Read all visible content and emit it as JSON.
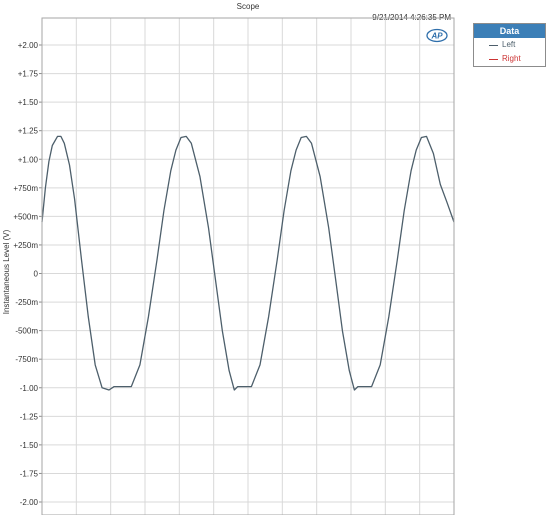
{
  "colors": {
    "left": "#4d5f6b",
    "right": "#cc3333",
    "grid": "#d9d9d9",
    "legend_header": "#3c7fb7"
  },
  "icons": {
    "logo": "ap-logo-icon"
  },
  "chart_data": {
    "type": "line",
    "title": "Scope",
    "timestamp": "9/21/2014 4:26:35 PM",
    "ylabel": "Instantaneous Level (V)",
    "xlabel": "",
    "ylim": [
      -2.1,
      2.1
    ],
    "yticks": [
      "+2.00",
      "+1.75",
      "+1.50",
      "+1.25",
      "+1.00",
      "+750m",
      "+500m",
      "+250m",
      "0",
      "-250m",
      "-500m",
      "-750m",
      "-1.00",
      "-1.25",
      "-1.50",
      "-1.75",
      "-2.00"
    ],
    "ytick_values": [
      2.0,
      1.75,
      1.5,
      1.25,
      1.0,
      0.75,
      0.5,
      0.25,
      0,
      -0.25,
      -0.5,
      -0.75,
      -1.0,
      -1.25,
      -1.5,
      -1.75,
      -2.0
    ],
    "xlim": [
      0,
      12
    ],
    "grid": true,
    "legend": {
      "title": "Data",
      "position": "top-right",
      "entries": [
        "Left",
        "Right"
      ]
    },
    "series": [
      {
        "name": "Left",
        "x": [
          0,
          0.1,
          0.2,
          0.3,
          0.45,
          0.55,
          0.65,
          0.8,
          0.95,
          1.15,
          1.35,
          1.55,
          1.75,
          1.95,
          2.1,
          2.2,
          2.6,
          2.85,
          3.1,
          3.35,
          3.55,
          3.75,
          3.9,
          4.05,
          4.2,
          4.35,
          4.6,
          4.85,
          5.05,
          5.25,
          5.45,
          5.6,
          5.7,
          6.1,
          6.35,
          6.6,
          6.85,
          7.05,
          7.25,
          7.4,
          7.55,
          7.7,
          7.85,
          8.1,
          8.35,
          8.55,
          8.75,
          8.95,
          9.1,
          9.2,
          9.6,
          9.85,
          10.1,
          10.35,
          10.55,
          10.75,
          10.9,
          11.05,
          11.2,
          11.4,
          11.6,
          11.8,
          12.0
        ],
        "y": [
          0.45,
          0.75,
          0.98,
          1.12,
          1.2,
          1.2,
          1.14,
          0.95,
          0.65,
          0.12,
          -0.38,
          -0.8,
          -1.0,
          -1.02,
          -0.99,
          -0.99,
          -0.99,
          -0.8,
          -0.38,
          0.12,
          0.55,
          0.9,
          1.08,
          1.19,
          1.2,
          1.14,
          0.85,
          0.4,
          -0.05,
          -0.5,
          -0.85,
          -1.02,
          -0.99,
          -0.99,
          -0.8,
          -0.38,
          0.12,
          0.55,
          0.9,
          1.08,
          1.19,
          1.2,
          1.14,
          0.85,
          0.4,
          -0.05,
          -0.5,
          -0.85,
          -1.02,
          -0.99,
          -0.99,
          -0.8,
          -0.38,
          0.12,
          0.55,
          0.9,
          1.08,
          1.19,
          1.2,
          1.05,
          0.78,
          0.62,
          0.45
        ]
      }
    ]
  }
}
